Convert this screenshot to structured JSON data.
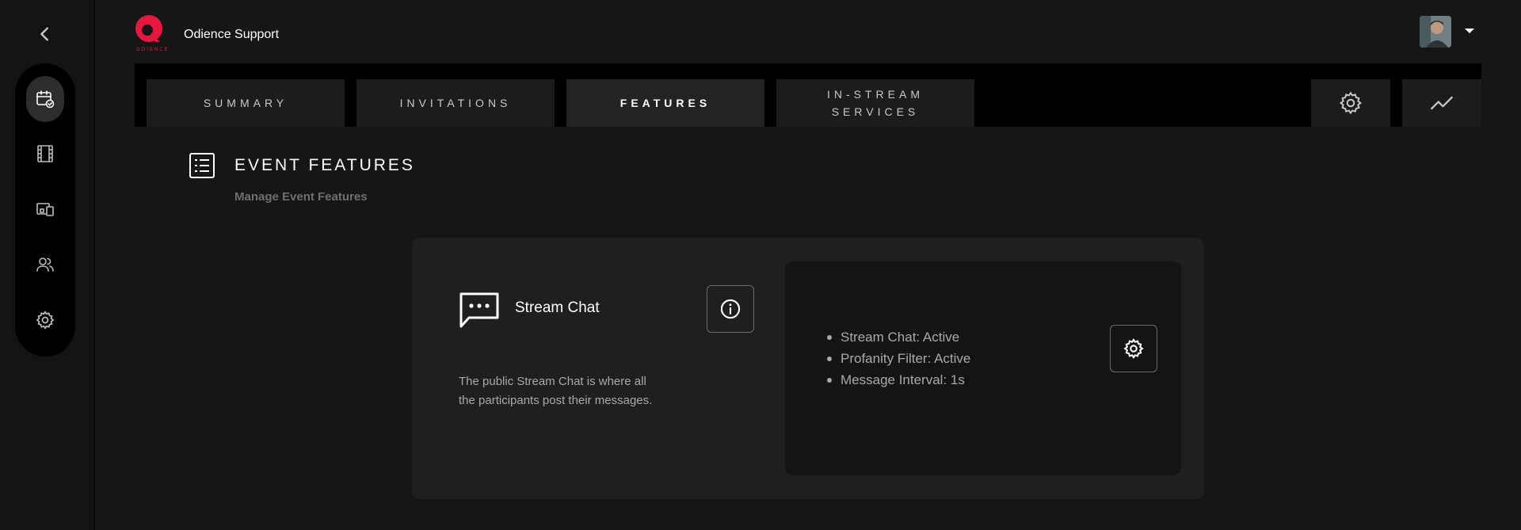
{
  "header": {
    "brand_title": "Odience Support"
  },
  "sidebar": {
    "items": [
      {
        "name": "events",
        "icon": "calendar-check-icon",
        "active": true
      },
      {
        "name": "media",
        "icon": "film-icon",
        "active": false
      },
      {
        "name": "devices",
        "icon": "devices-icon",
        "active": false
      },
      {
        "name": "users",
        "icon": "users-icon",
        "active": false
      },
      {
        "name": "settings",
        "icon": "gear-icon",
        "active": false
      }
    ]
  },
  "tabs": {
    "summary": "SUMMARY",
    "invitations": "INVITATIONS",
    "features": "FEATURES",
    "in_stream_line1": "IN-STREAM",
    "in_stream_line2": "SERVICES",
    "active": "features"
  },
  "section": {
    "title": "EVENT FEATURES",
    "subtitle": "Manage Event Features"
  },
  "feature": {
    "name": "Stream Chat",
    "description": "The public Stream Chat is where all the participants post their messages.",
    "status": [
      "Stream Chat: Active",
      "Profanity Filter: Active",
      "Message Interval: 1s"
    ]
  },
  "colors": {
    "background": "#161616",
    "rail": "#131313",
    "card": "#1f1f1f",
    "panel": "#141414",
    "brand_red": "#e5173f"
  }
}
